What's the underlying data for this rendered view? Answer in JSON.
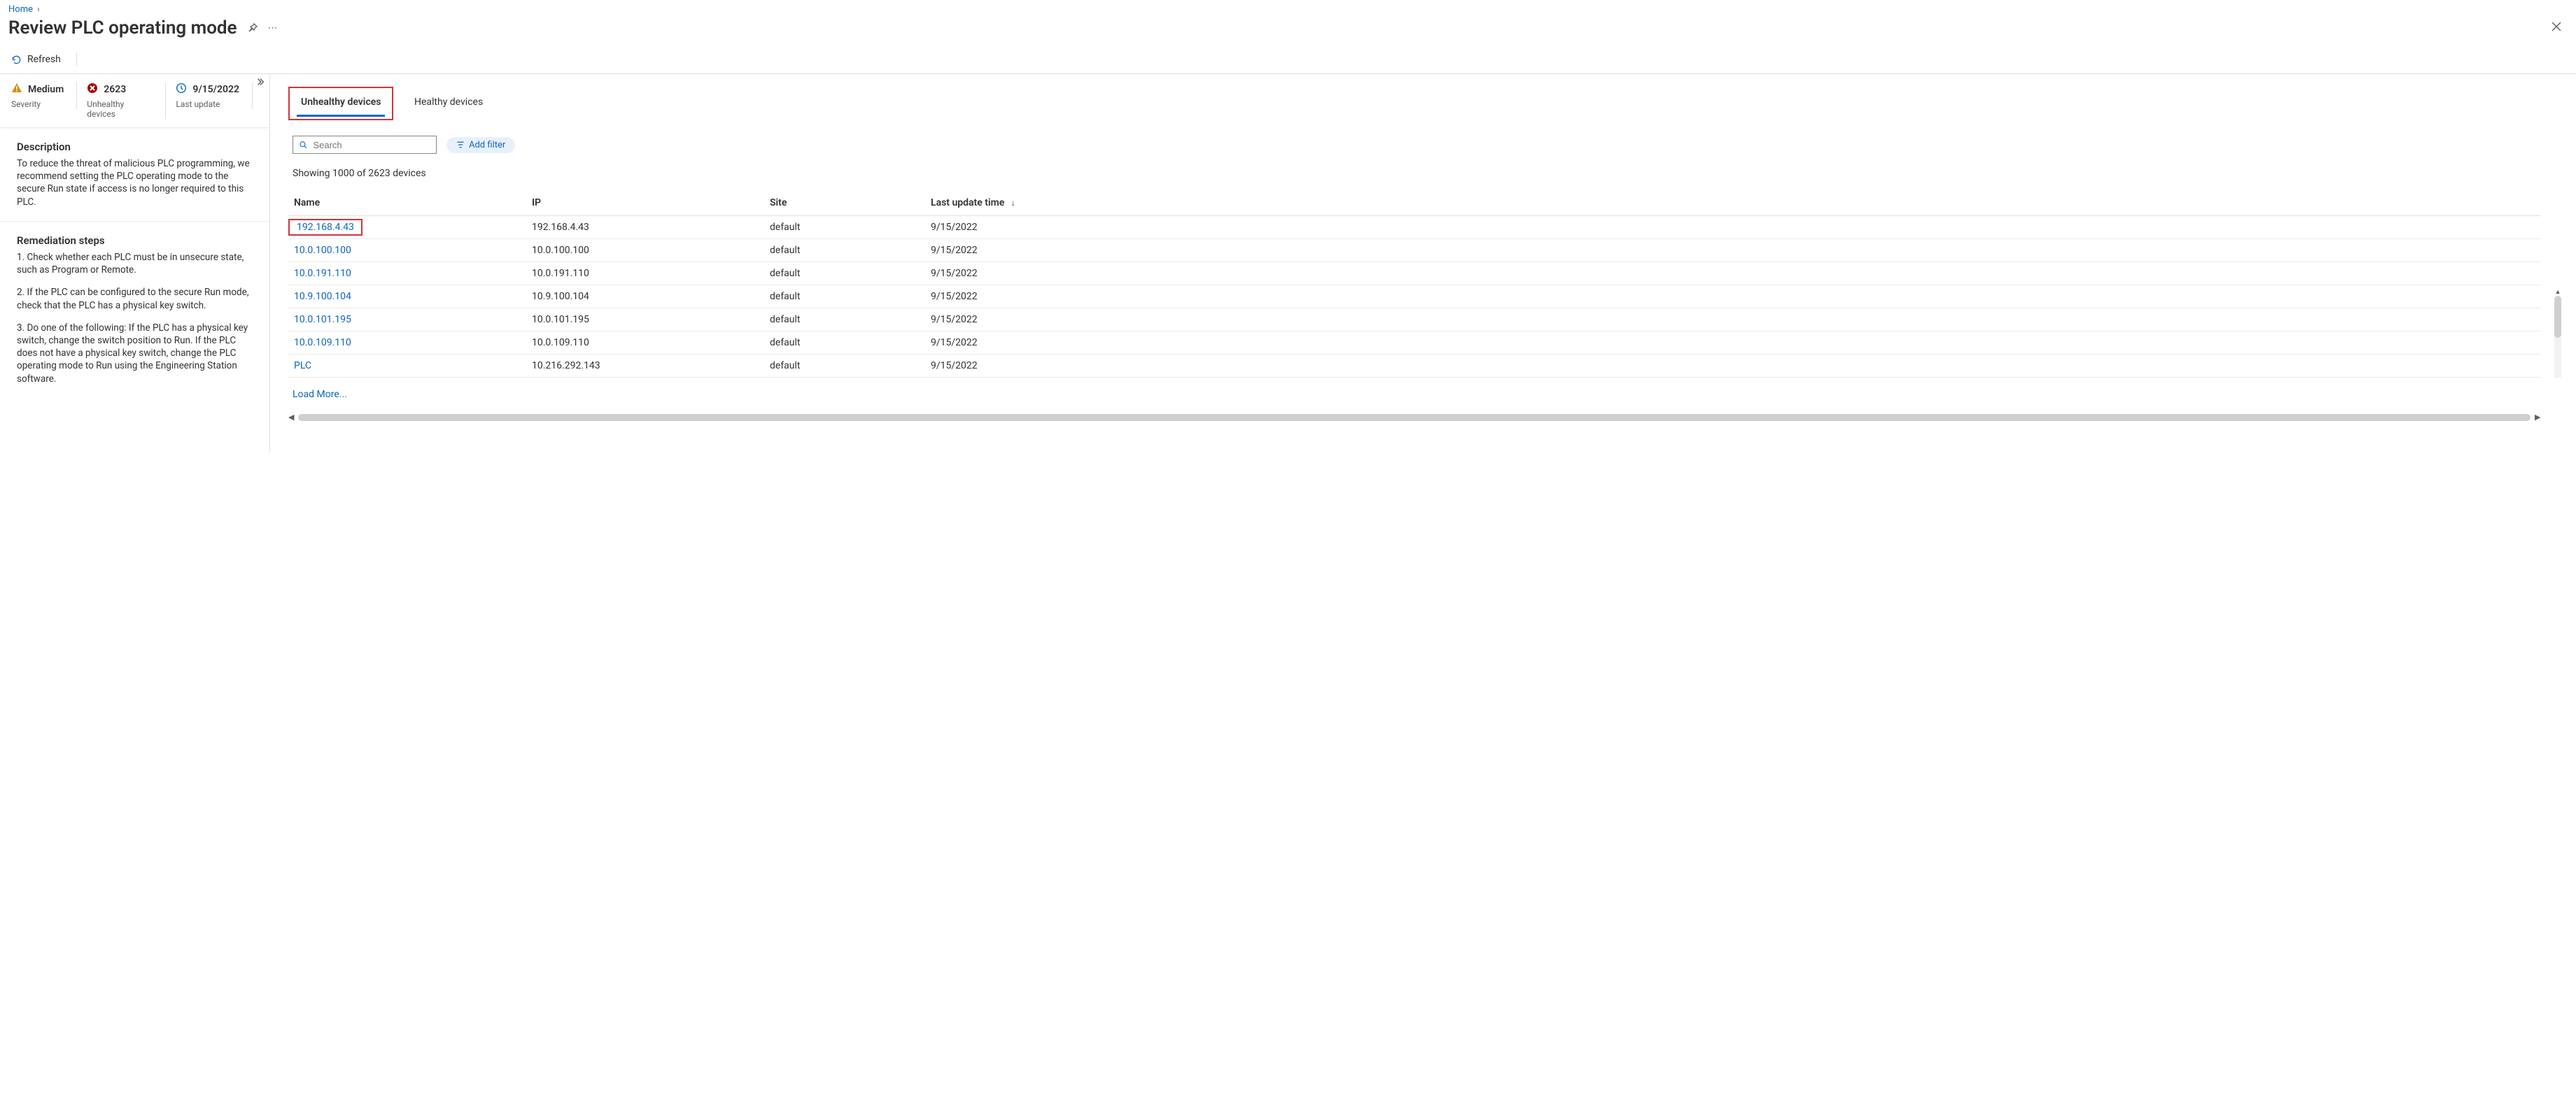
{
  "breadcrumb": {
    "home": "Home"
  },
  "page": {
    "title": "Review PLC operating mode"
  },
  "commands": {
    "refresh": "Refresh"
  },
  "metrics": {
    "severity": {
      "value": "Medium",
      "label": "Severity"
    },
    "unhealthy": {
      "value": "2623",
      "label": "Unhealthy devices"
    },
    "last_update": {
      "value": "9/15/2022",
      "label": "Last update"
    }
  },
  "description": {
    "heading": "Description",
    "body": "To reduce the threat of malicious PLC programming, we recommend setting the PLC operating mode to the secure Run state if access is no longer required to this PLC."
  },
  "remediation": {
    "heading": "Remediation steps",
    "steps": [
      "1. Check whether each PLC must be in unsecure state, such as Program or Remote.",
      "2. If the PLC can be configured to the secure Run mode, check that the PLC has a physical key switch.",
      "3. Do one of the following: If the PLC has a physical key switch, change the switch position to Run. If the PLC does not have a physical key switch, change the PLC operating mode to Run using the Engineering Station software."
    ]
  },
  "tabs": {
    "unhealthy": "Unhealthy devices",
    "healthy": "Healthy devices"
  },
  "filter": {
    "search_placeholder": "Search",
    "add_filter": "Add filter"
  },
  "table": {
    "showing": "Showing 1000 of 2623 devices",
    "columns": {
      "name": "Name",
      "ip": "IP",
      "site": "Site",
      "last_update": "Last update time"
    },
    "rows": [
      {
        "name": "192.168.4.43",
        "ip": "192.168.4.43",
        "site": "default",
        "last_update": "9/15/2022"
      },
      {
        "name": "10.0.100.100",
        "ip": "10.0.100.100",
        "site": "default",
        "last_update": "9/15/2022"
      },
      {
        "name": "10.0.191.110",
        "ip": "10.0.191.110",
        "site": "default",
        "last_update": "9/15/2022"
      },
      {
        "name": "10.9.100.104",
        "ip": "10.9.100.104",
        "site": "default",
        "last_update": "9/15/2022"
      },
      {
        "name": "10.0.101.195",
        "ip": "10.0.101.195",
        "site": "default",
        "last_update": "9/15/2022"
      },
      {
        "name": "10.0.109.110",
        "ip": "10.0.109.110",
        "site": "default",
        "last_update": "9/15/2022"
      },
      {
        "name": "PLC",
        "ip": "10.216.292.143",
        "site": "default",
        "last_update": "9/15/2022"
      }
    ],
    "load_more": "Load More..."
  }
}
